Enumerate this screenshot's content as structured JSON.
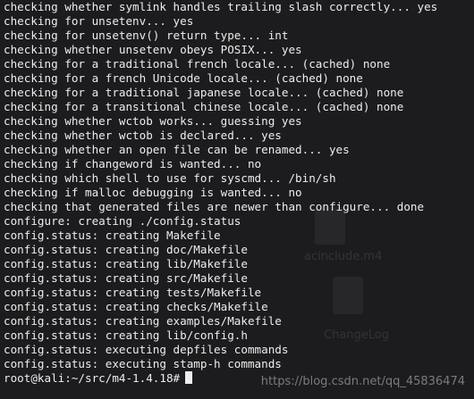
{
  "terminal": {
    "lines": [
      "checking whether symlink handles trailing slash correctly... yes",
      "checking for unsetenv... yes",
      "checking for unsetenv() return type... int",
      "checking whether unsetenv obeys POSIX... yes",
      "checking for a traditional french locale... (cached) none",
      "checking for a french Unicode locale... (cached) none",
      "checking for a traditional japanese locale... (cached) none",
      "checking for a transitional chinese locale... (cached) none",
      "checking whether wctob works... guessing yes",
      "checking whether wctob is declared... yes",
      "checking whether an open file can be renamed... yes",
      "checking if changeword is wanted... no",
      "checking which shell to use for syscmd... /bin/sh",
      "checking if malloc debugging is wanted... no",
      "checking that generated files are newer than configure... done",
      "configure: creating ./config.status",
      "config.status: creating Makefile",
      "config.status: creating doc/Makefile",
      "config.status: creating lib/Makefile",
      "config.status: creating src/Makefile",
      "config.status: creating tests/Makefile",
      "config.status: creating checks/Makefile",
      "config.status: creating examples/Makefile",
      "config.status: creating lib/config.h",
      "config.status: executing depfiles commands",
      "config.status: executing stamp-h commands"
    ],
    "prompt": "root@kali:~/src/m4-1.4.18#"
  },
  "background": {
    "ghost_label_1": "acinclude.m4",
    "ghost_label_2": "ChangeLog"
  },
  "watermark": "https://blog.csdn.net/qq_45836474",
  "colors": {
    "background": "#1c1c1e",
    "text": "#ededed"
  }
}
